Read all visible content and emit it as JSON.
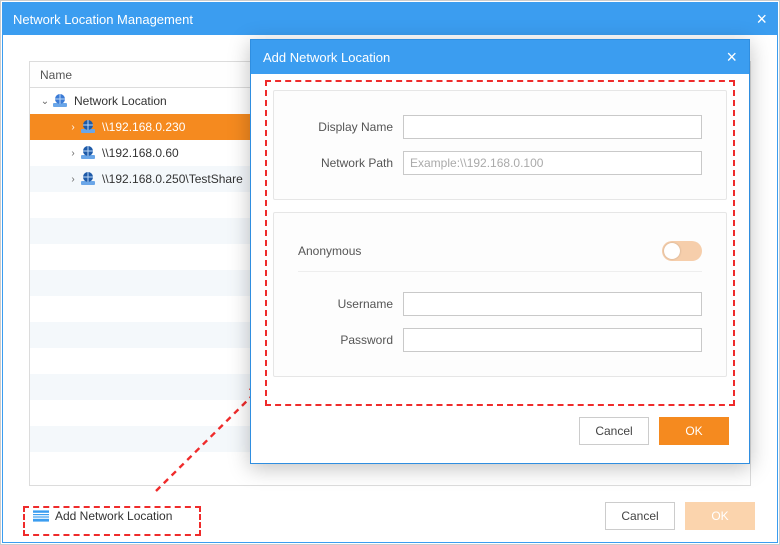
{
  "main": {
    "title": "Network Location Management",
    "column_header": "Name",
    "root_label": "Network Location",
    "items": [
      {
        "label": "\\\\192.168.0.230",
        "selected": true
      },
      {
        "label": "\\\\192.168.0.60",
        "selected": false
      },
      {
        "label": "\\\\192.168.0.250\\TestShare",
        "selected": false
      }
    ],
    "add_link_label": "Add Network Location",
    "cancel_label": "Cancel",
    "ok_label": "OK"
  },
  "dialog": {
    "title": "Add Network Location",
    "display_name_label": "Display Name",
    "display_name_value": "",
    "network_path_label": "Network Path",
    "network_path_value": "",
    "network_path_placeholder": "Example:\\\\192.168.0.100",
    "anonymous_label": "Anonymous",
    "anonymous_on": false,
    "username_label": "Username",
    "username_value": "",
    "password_label": "Password",
    "password_value": "",
    "cancel_label": "Cancel",
    "ok_label": "OK"
  },
  "icons": {
    "network_globe": "network-globe-icon",
    "add_location": "add-location-icon"
  },
  "colors": {
    "accent_blue": "#3b9df0",
    "accent_orange": "#f58a1f",
    "annotation_red": "#ef2b2b"
  }
}
